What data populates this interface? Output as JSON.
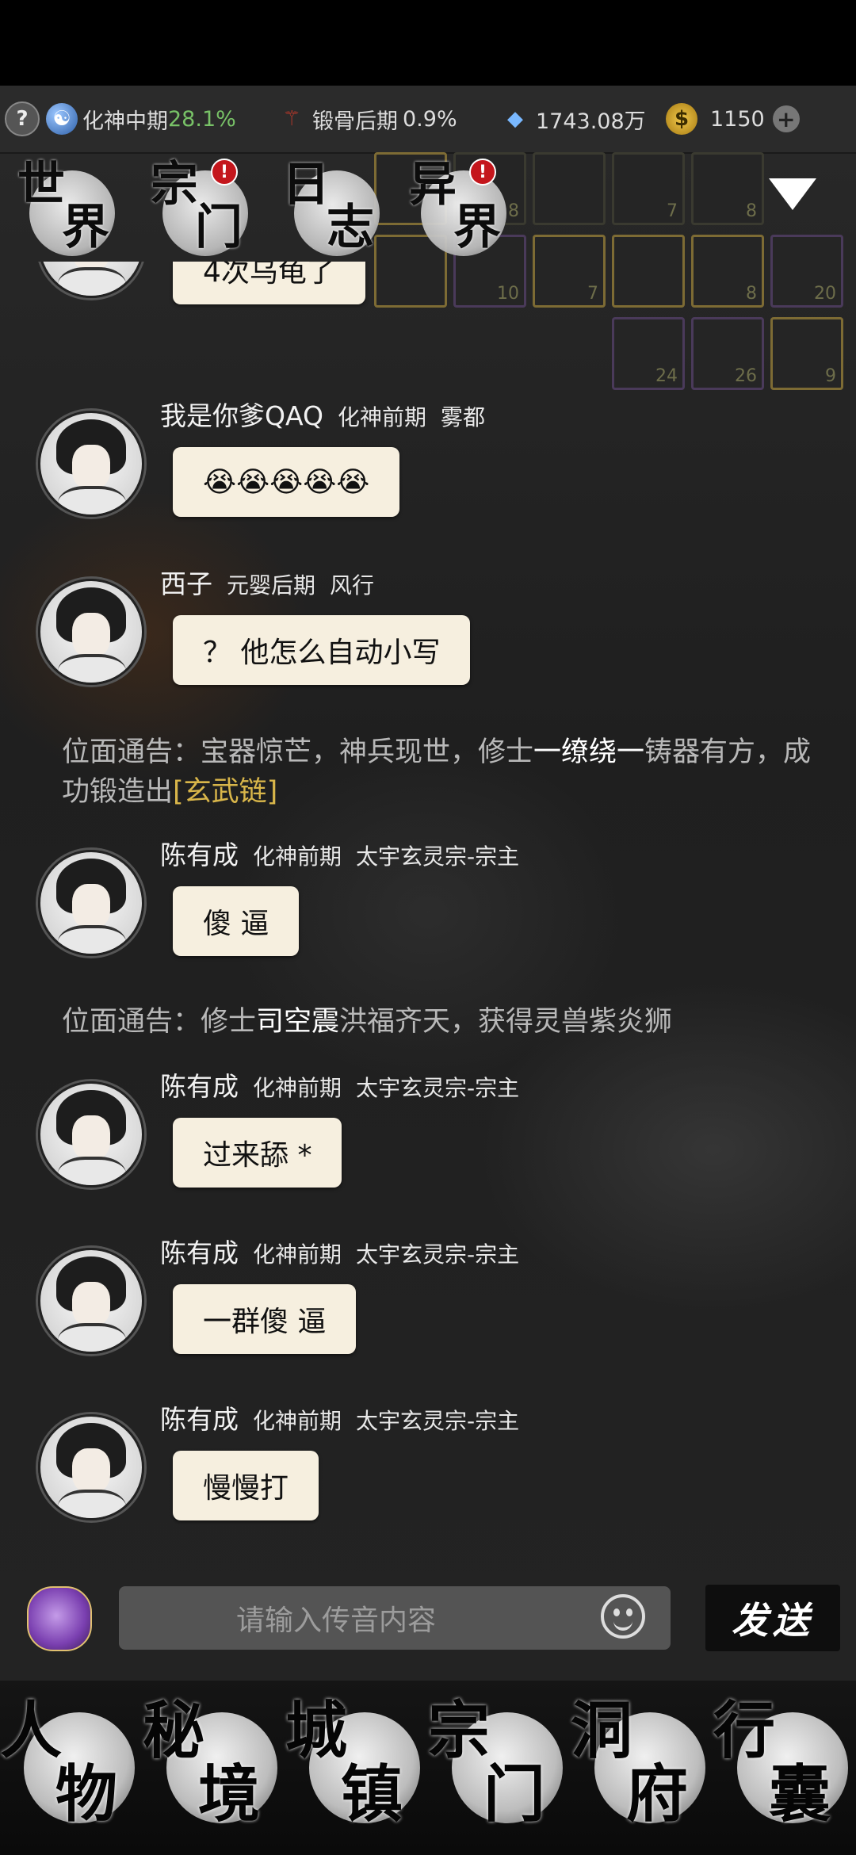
{
  "resources": {
    "help": "?",
    "cultivation": {
      "realm": "化神中期",
      "percent": "28.1%"
    },
    "body": {
      "realm": "锻骨后期",
      "percent": "0.9%"
    },
    "spirit_stones": "1743.08万",
    "gold": "1150",
    "plus": "+"
  },
  "top_nav": [
    {
      "c1": "世",
      "c2": "界",
      "badge": ""
    },
    {
      "c1": "宗",
      "c2": "门",
      "badge": "!"
    },
    {
      "c1": "日",
      "c2": "志",
      "badge": ""
    },
    {
      "c1": "异",
      "c2": "界",
      "badge": "!"
    }
  ],
  "inventory_counts": [
    "8",
    "7",
    "8",
    "10",
    "7",
    "8",
    "20",
    "24",
    "26",
    "9"
  ],
  "messages": [
    {
      "type": "chat",
      "name": "",
      "realm": "",
      "place": "",
      "text": "4次乌龟了"
    },
    {
      "type": "chat",
      "name": "我是你爹QAQ",
      "realm": "化神前期",
      "place": "雾都",
      "text": "😭😭😭😭😭"
    },
    {
      "type": "chat",
      "name": "西子",
      "realm": "元婴后期",
      "place": "风行",
      "text": "？ 他怎么自动小写"
    },
    {
      "type": "notice",
      "prefix": "位面通告：宝器惊芒，神兵现世，修士",
      "player": "一缭绕一",
      "middle": "铸器有方，成功锻造出",
      "item": "[玄武链]",
      "suffix": ""
    },
    {
      "type": "chat",
      "name": "陈有成",
      "realm": "化神前期",
      "place": "太宇玄灵宗-宗主",
      "text": "傻 逼"
    },
    {
      "type": "notice",
      "prefix": "位面通告：修士",
      "player": "司空震",
      "middle": "洪福齐天，获得灵兽紫炎狮",
      "item": "",
      "suffix": ""
    },
    {
      "type": "chat",
      "name": "陈有成",
      "realm": "化神前期",
      "place": "太宇玄灵宗-宗主",
      "text": "过来舔 *"
    },
    {
      "type": "chat",
      "name": "陈有成",
      "realm": "化神前期",
      "place": "太宇玄灵宗-宗主",
      "text": "一群傻 逼"
    },
    {
      "type": "chat",
      "name": "陈有成",
      "realm": "化神前期",
      "place": "太宇玄灵宗-宗主",
      "text": "慢慢打"
    }
  ],
  "input": {
    "placeholder": "请输入传音内容",
    "send_label": "发送"
  },
  "bottom_nav": [
    {
      "c1": "人",
      "c2": "物"
    },
    {
      "c1": "秘",
      "c2": "境"
    },
    {
      "c1": "城",
      "c2": "镇"
    },
    {
      "c1": "宗",
      "c2": "门"
    },
    {
      "c1": "洞",
      "c2": "府"
    },
    {
      "c1": "行",
      "c2": "囊"
    }
  ]
}
